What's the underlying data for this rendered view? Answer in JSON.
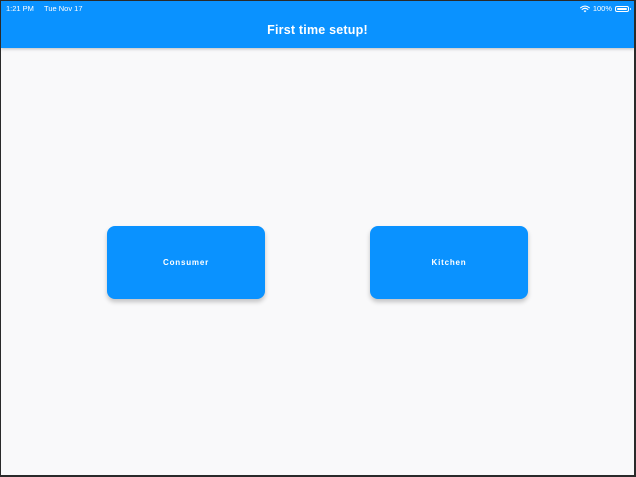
{
  "status_bar": {
    "time": "1:21 PM",
    "date": "Tue Nov 17",
    "battery": "100%",
    "icons": [
      "wifi-icon",
      "battery-icon"
    ]
  },
  "appbar": {
    "title": "First time setup!"
  },
  "buttons": {
    "consumer": "Consumer",
    "kitchen": "Kitchen"
  },
  "colors": {
    "primary": "#0a92ff",
    "background": "#f9f9fa",
    "text_on_primary": "#ffffff"
  }
}
